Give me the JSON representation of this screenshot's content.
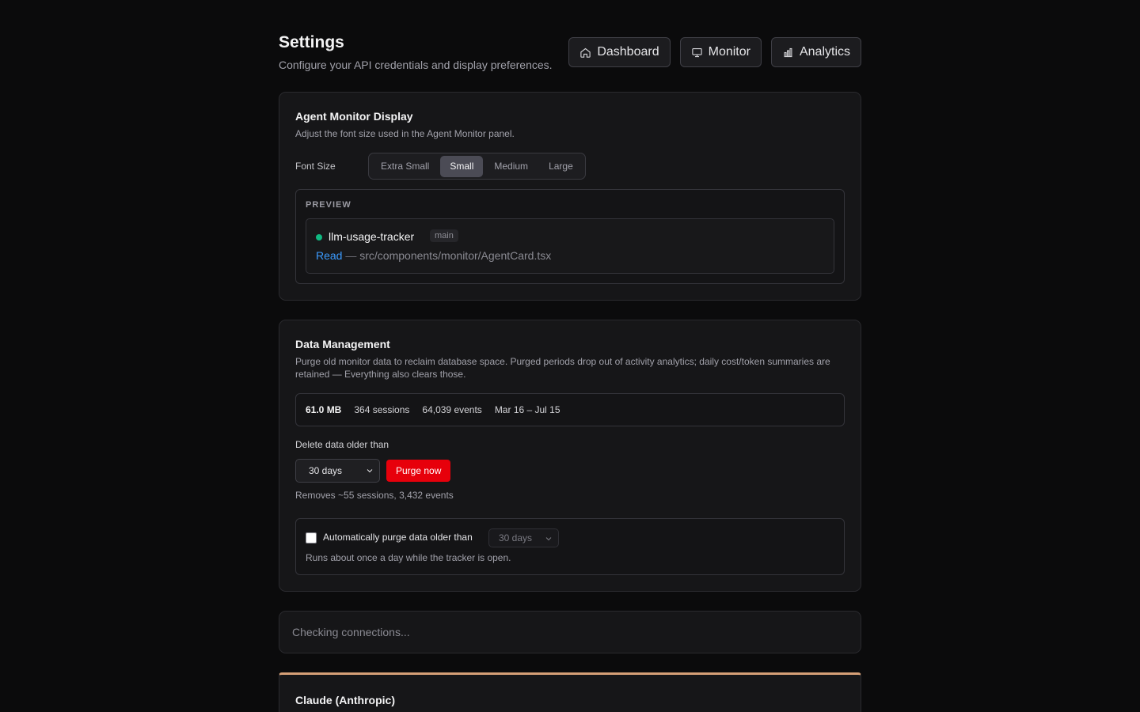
{
  "header": {
    "title": "Settings",
    "subtitle": "Configure your API credentials and display preferences.",
    "nav": [
      {
        "label": "Dashboard",
        "icon": "home-icon"
      },
      {
        "label": "Monitor",
        "icon": "monitor-icon"
      },
      {
        "label": "Analytics",
        "icon": "bar-chart-icon"
      }
    ]
  },
  "display": {
    "title": "Agent Monitor Display",
    "description": "Adjust the font size used in the Agent Monitor panel.",
    "font_size_label": "Font Size",
    "options": [
      "Extra Small",
      "Small",
      "Medium",
      "Large"
    ],
    "selected": "Small",
    "preview_label": "PREVIEW",
    "preview": {
      "status_color": "#10b981",
      "agent_name": "llm-usage-tracker",
      "branch": "main",
      "verb": "Read",
      "separator": "—",
      "path": "src/components/monitor/AgentCard.tsx"
    }
  },
  "data_management": {
    "title": "Data Management",
    "description": "Purge old monitor data to reclaim database space. Purged periods drop out of activity analytics; daily cost/token summaries are retained — Everything also clears those.",
    "stats": {
      "size": "61.0 MB",
      "sessions": "364 sessions",
      "events": "64,039 events",
      "range": "Mar 16 – Jul 15"
    },
    "delete_label": "Delete data older than",
    "age_value": "30 days",
    "purge_label": "Purge now",
    "purge_color": "#e7000b",
    "removes_text": "Removes ~55 sessions, 3,432 events",
    "auto_purge": {
      "checked": false,
      "label": "Automatically purge data older than",
      "value": "30 days",
      "note": "Runs about once a day while the tracker is open."
    }
  },
  "connections": {
    "status_text": "Checking connections..."
  },
  "provider": {
    "title": "Claude (Anthropic)",
    "accent": "#d6a077"
  }
}
